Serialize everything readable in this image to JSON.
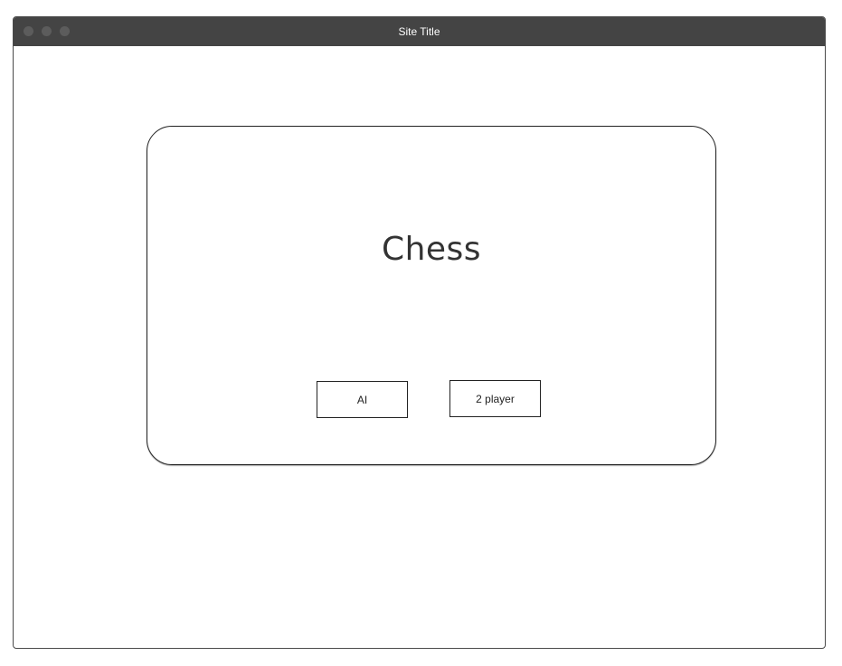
{
  "window": {
    "title": "Site Title"
  },
  "main": {
    "title": "Chess",
    "buttons": {
      "ai_label": "AI",
      "two_player_label": "2 player"
    }
  }
}
